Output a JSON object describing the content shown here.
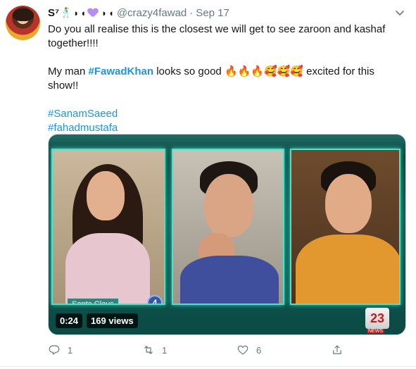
{
  "tweet": {
    "display_name": "S⁷",
    "name_emoji_1": "🕺",
    "name_emoji_2": "◗",
    "name_emoji_3": "◖",
    "name_emoji_4": "◗",
    "name_emoji_5": "◖",
    "handle": "@crazy4fawad",
    "separator": "·",
    "date": "Sep 17",
    "line1": "Do you all realise this is the closest we will get to see zaroon and kashaf together!!!!",
    "line2_prefix": "My man ",
    "line2_hashtag": "#FawadKhan",
    "line2_suffix": " looks so good 🔥🔥🔥🥰🥰🥰 excited for this show!!",
    "hashtag_1": "#SanamSaeed",
    "hashtag_2": "#fahadmustafa"
  },
  "media": {
    "chyron": "Santa Claus",
    "badge": "4",
    "duration": "0:24",
    "views": "169 views",
    "channel_logo": "23",
    "channel_sub": "NEWS"
  },
  "actions": {
    "reply_count": "1",
    "retweet_count": "1",
    "like_count": "6"
  },
  "colors": {
    "link": "#1b95e0",
    "muted": "#657786",
    "panel_glow": "#4fe0c6"
  },
  "icons": [
    "chevron-down-icon",
    "reply-icon",
    "retweet-icon",
    "like-icon",
    "share-icon"
  ]
}
